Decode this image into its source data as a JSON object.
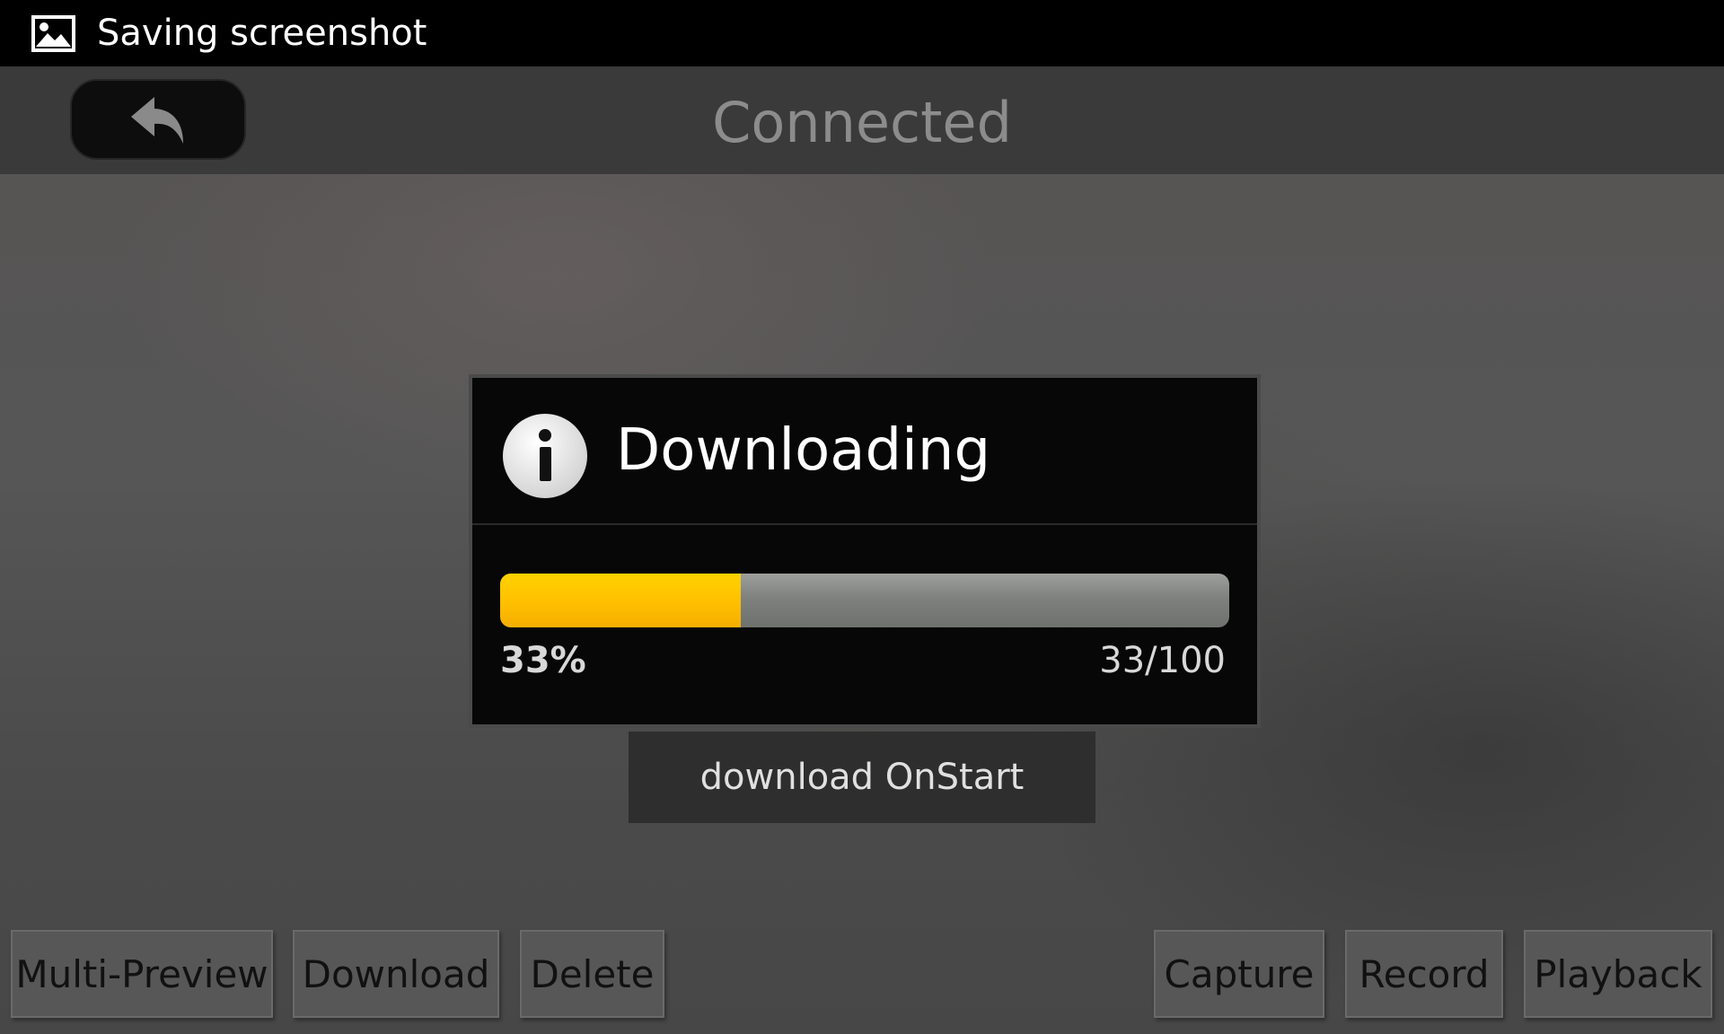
{
  "status_bar": {
    "icon": "image-icon",
    "text": "Saving screenshot"
  },
  "top_bar": {
    "back_icon": "reply-arrow-icon",
    "title": "Connected"
  },
  "dialog": {
    "icon": "info-icon",
    "title": "Downloading",
    "progress_fraction": 0.33,
    "percent_text": "33%",
    "count_text": "33/100",
    "progress_color": "#ffc400",
    "track_color": "#8a8d89"
  },
  "toast": {
    "text": "download OnStart"
  },
  "bottom_buttons": [
    "Multi-Preview",
    "Download",
    "Delete",
    "Capture",
    "Record",
    "Playback"
  ]
}
